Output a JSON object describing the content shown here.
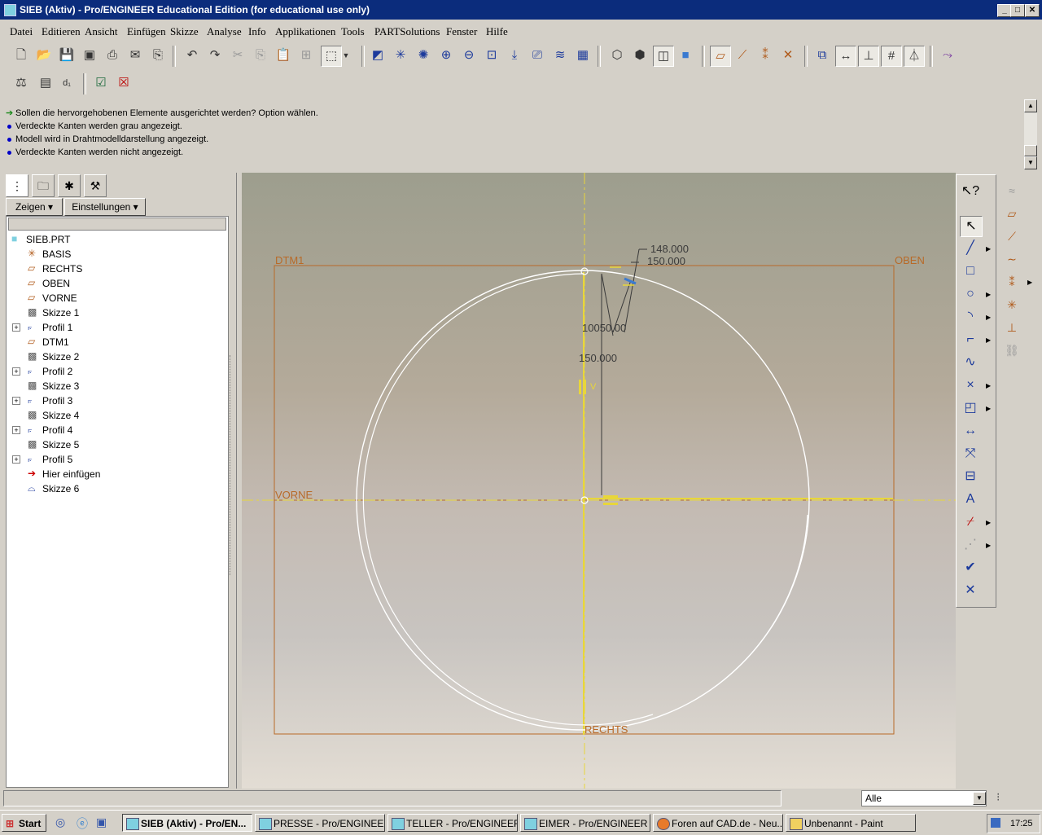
{
  "window": {
    "title": "SIEB (Aktiv) - Pro/ENGINEER Educational Edition (for educational use only)",
    "min_label": "_",
    "max_label": "□",
    "close_label": "✕"
  },
  "menu": [
    "Datei",
    "Editieren",
    "Ansicht",
    "Einfügen",
    "Skizze",
    "Analyse",
    "Info",
    "Applikationen",
    "Tools",
    "PARTSolutions",
    "Fenster",
    "Hilfe"
  ],
  "messages": {
    "prompt": "Sollen die hervorgehobenen Elemente ausgerichtet werden? Option wählen.",
    "lines": [
      "Verdeckte Kanten werden grau angezeigt.",
      "Modell wird in Drahtmodelldarstellung angezeigt.",
      "Verdeckte Kanten werden nicht angezeigt."
    ]
  },
  "panel": {
    "show_label": "Zeigen",
    "settings_label": "Einstellungen",
    "tree": [
      {
        "label": "SIEB.PRT",
        "icon": "part-icon",
        "level": 0,
        "expandable": false
      },
      {
        "label": "BASIS",
        "icon": "csys-icon",
        "level": 1,
        "expandable": false
      },
      {
        "label": "RECHTS",
        "icon": "datum-plane-icon",
        "level": 1,
        "expandable": false
      },
      {
        "label": "OBEN",
        "icon": "datum-plane-icon",
        "level": 1,
        "expandable": false
      },
      {
        "label": "VORNE",
        "icon": "datum-plane-icon",
        "level": 1,
        "expandable": false
      },
      {
        "label": "Skizze 1",
        "icon": "sketch-icon",
        "level": 1,
        "expandable": false
      },
      {
        "label": "Profil 1",
        "icon": "profile-icon",
        "level": 1,
        "expandable": true
      },
      {
        "label": "DTM1",
        "icon": "datum-plane-icon",
        "level": 1,
        "expandable": false
      },
      {
        "label": "Skizze 2",
        "icon": "sketch-icon",
        "level": 1,
        "expandable": false
      },
      {
        "label": "Profil 2",
        "icon": "profile-icon",
        "level": 1,
        "expandable": true
      },
      {
        "label": "Skizze 3",
        "icon": "sketch-icon",
        "level": 1,
        "expandable": false
      },
      {
        "label": "Profil 3",
        "icon": "profile-icon",
        "level": 1,
        "expandable": true
      },
      {
        "label": "Skizze 4",
        "icon": "sketch-icon",
        "level": 1,
        "expandable": false
      },
      {
        "label": "Profil 4",
        "icon": "profile-icon",
        "level": 1,
        "expandable": true
      },
      {
        "label": "Skizze 5",
        "icon": "sketch-icon",
        "level": 1,
        "expandable": false
      },
      {
        "label": "Profil 5",
        "icon": "profile-icon",
        "level": 1,
        "expandable": true
      },
      {
        "label": "Hier einfügen",
        "icon": "insert-here-icon",
        "level": 1,
        "expandable": false
      },
      {
        "label": "Skizze 6",
        "icon": "active-sketch-icon",
        "level": 1,
        "expandable": false
      }
    ]
  },
  "graphics": {
    "planes": {
      "dtm1": "DTM1",
      "oben": "OBEN",
      "vorne": "VORNE",
      "rechts": "RECHTS"
    },
    "dimensions": {
      "d1": "148.000",
      "d2": "150.000",
      "d3": "150.000",
      "overlap": "10050.00",
      "constraint": "V"
    }
  },
  "status": {
    "filter_value": "Alle"
  },
  "taskbar": {
    "start_label": "Start",
    "tasks": [
      "SIEB (Aktiv) - Pro/EN...",
      "PRESSE - Pro/ENGINEER ...",
      "TELLER - Pro/ENGINEER ...",
      "EIMER - Pro/ENGINEER E...",
      "Foren auf CAD.de - Neu...",
      "Unbenannt - Paint"
    ],
    "clock": "17:25"
  },
  "colors": {
    "titlebar": "#0b2c7c",
    "datum": "#b86a28",
    "axis": "#e8d63a",
    "highlight_dim": "#3a3a3a"
  }
}
